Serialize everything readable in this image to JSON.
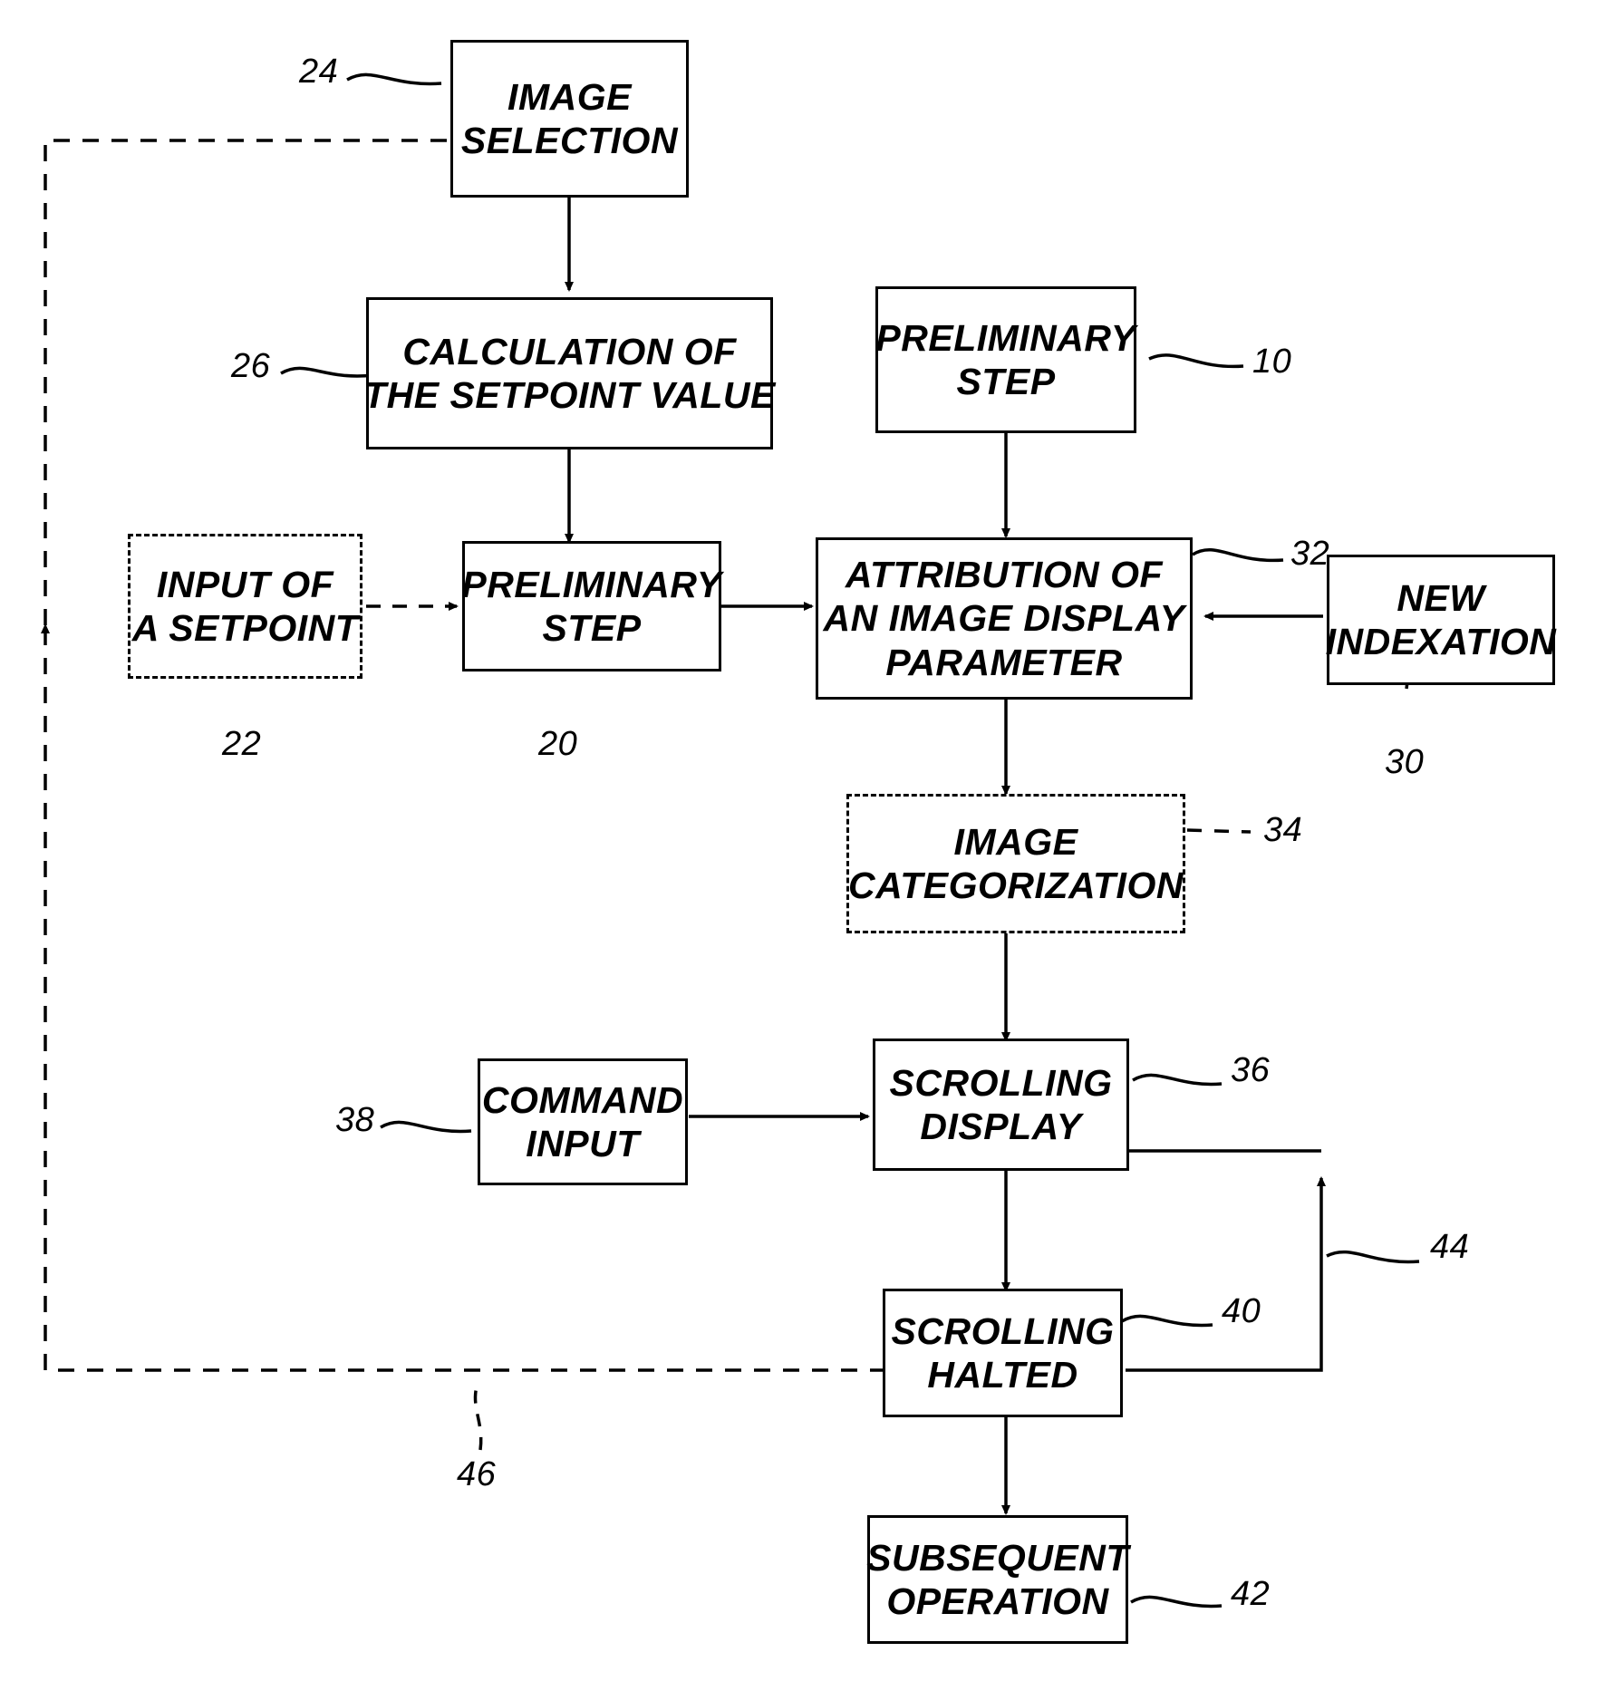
{
  "figure": {
    "type": "flowchart",
    "title": "Image display process flow diagram"
  },
  "nodes": [
    {
      "id": "n24",
      "ref": "24",
      "lines": [
        "IMAGE",
        "SELECTION"
      ],
      "style": "solid"
    },
    {
      "id": "n26",
      "ref": "26",
      "lines": [
        "CALCULATION OF",
        "THE SETPOINT VALUE"
      ],
      "style": "solid"
    },
    {
      "id": "n10",
      "ref": "10",
      "lines": [
        "PRELIMINARY",
        "STEP"
      ],
      "style": "solid"
    },
    {
      "id": "n22",
      "ref": "22",
      "lines": [
        "INPUT OF",
        "A SETPOINT"
      ],
      "style": "dashed"
    },
    {
      "id": "n20",
      "ref": "20",
      "lines": [
        "PRELIMINARY",
        "STEP"
      ],
      "style": "solid"
    },
    {
      "id": "n32",
      "ref": "32",
      "lines": [
        "ATTRIBUTION OF",
        "AN IMAGE DISPLAY",
        "PARAMETER"
      ],
      "style": "solid"
    },
    {
      "id": "n30",
      "ref": "30",
      "lines": [
        "NEW",
        "INDEXATION"
      ],
      "style": "solid"
    },
    {
      "id": "n34",
      "ref": "34",
      "lines": [
        "IMAGE",
        "CATEGORIZATION"
      ],
      "style": "dashed"
    },
    {
      "id": "n38",
      "ref": "38",
      "lines": [
        "COMMAND",
        "INPUT"
      ],
      "style": "solid"
    },
    {
      "id": "n36",
      "ref": "36",
      "lines": [
        "SCROLLING",
        "DISPLAY"
      ],
      "style": "solid"
    },
    {
      "id": "n40",
      "ref": "40",
      "lines": [
        "SCROLLING",
        "HALTED"
      ],
      "style": "solid"
    },
    {
      "id": "n42",
      "ref": "42",
      "lines": [
        "SUBSEQUENT",
        "OPERATION"
      ],
      "style": "solid"
    }
  ],
  "reference_numerals": [
    {
      "id": "r24",
      "label": "24"
    },
    {
      "id": "r26",
      "label": "26"
    },
    {
      "id": "r10",
      "label": "10"
    },
    {
      "id": "r22",
      "label": "22"
    },
    {
      "id": "r20",
      "label": "20"
    },
    {
      "id": "r32",
      "label": "32"
    },
    {
      "id": "r30",
      "label": "30"
    },
    {
      "id": "r34",
      "label": "34"
    },
    {
      "id": "r38",
      "label": "38"
    },
    {
      "id": "r36",
      "label": "36"
    },
    {
      "id": "r44",
      "label": "44"
    },
    {
      "id": "r40",
      "label": "40"
    },
    {
      "id": "r46",
      "label": "46"
    },
    {
      "id": "r42",
      "label": "42"
    }
  ],
  "connectors": [
    {
      "id": "c1",
      "from": "n24",
      "to": "n26",
      "style": "solid"
    },
    {
      "id": "c2",
      "from": "n26",
      "to": "n20",
      "style": "solid"
    },
    {
      "id": "c3",
      "from": "n10",
      "to": "n32",
      "style": "solid"
    },
    {
      "id": "c4",
      "from": "n22",
      "to": "n20",
      "style": "dashed"
    },
    {
      "id": "c5",
      "from": "n20",
      "to": "n32",
      "style": "solid"
    },
    {
      "id": "c6",
      "from": "n30",
      "to": "n32",
      "style": "solid"
    },
    {
      "id": "c7",
      "from": "n32",
      "to": "n34",
      "style": "solid"
    },
    {
      "id": "c8",
      "from": "n34",
      "to": "n36",
      "style": "solid"
    },
    {
      "id": "c9",
      "from": "n38",
      "to": "n36",
      "style": "solid"
    },
    {
      "id": "c10",
      "from": "n36",
      "to": "n40",
      "style": "solid"
    },
    {
      "id": "c11",
      "from": "n40",
      "to": "n42",
      "style": "solid"
    },
    {
      "id": "c12",
      "from": "n40",
      "to": "n36",
      "style": "solid",
      "note": "feedback loop 44"
    },
    {
      "id": "c13",
      "from": "n40",
      "to": "n24",
      "style": "dashed",
      "note": "feedback loop 46"
    }
  ]
}
